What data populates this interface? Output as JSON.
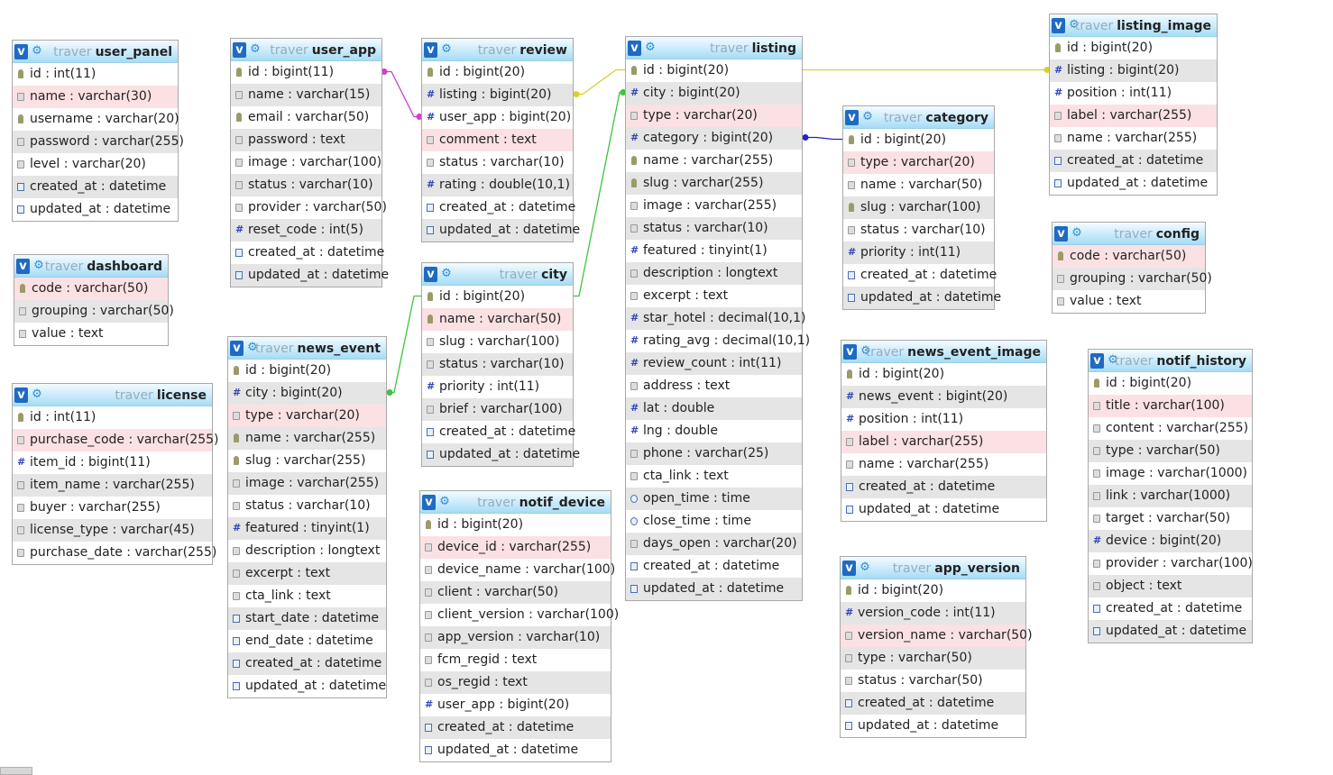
{
  "db_name": "traver",
  "toggle_glyph": "v",
  "gear_icon": "settings-icon",
  "relation_colors": {
    "user_app": "#d23cd0",
    "listing": "#d8d12a",
    "city": "#3ec43e",
    "category": "#2323c8"
  },
  "tables": [
    {
      "name": "user_panel",
      "columns": [
        {
          "text": "id : int(11)",
          "icon": "key"
        },
        {
          "text": "name : varchar(30)",
          "icon": "str",
          "hl": true
        },
        {
          "text": "username : varchar(20)",
          "icon": "key"
        },
        {
          "text": "password : varchar(255)",
          "icon": "str"
        },
        {
          "text": "level : varchar(20)",
          "icon": "str"
        },
        {
          "text": "created_at : datetime",
          "icon": "date"
        },
        {
          "text": "updated_at : datetime",
          "icon": "date"
        }
      ]
    },
    {
      "name": "user_app",
      "columns": [
        {
          "text": "id : bigint(11)",
          "icon": "key"
        },
        {
          "text": "name : varchar(15)",
          "icon": "str"
        },
        {
          "text": "email : varchar(50)",
          "icon": "key"
        },
        {
          "text": "password : text",
          "icon": "str"
        },
        {
          "text": "image : varchar(100)",
          "icon": "str"
        },
        {
          "text": "status : varchar(10)",
          "icon": "str"
        },
        {
          "text": "provider : varchar(50)",
          "icon": "str"
        },
        {
          "text": "reset_code : int(5)",
          "icon": "num"
        },
        {
          "text": "created_at : datetime",
          "icon": "date"
        },
        {
          "text": "updated_at : datetime",
          "icon": "date"
        }
      ]
    },
    {
      "name": "review",
      "columns": [
        {
          "text": "id : bigint(20)",
          "icon": "key"
        },
        {
          "text": "listing : bigint(20)",
          "icon": "num"
        },
        {
          "text": "user_app : bigint(20)",
          "icon": "num"
        },
        {
          "text": "comment : text",
          "icon": "str",
          "hl": true
        },
        {
          "text": "status : varchar(10)",
          "icon": "str"
        },
        {
          "text": "rating : double(10,1)",
          "icon": "num"
        },
        {
          "text": "created_at : datetime",
          "icon": "date"
        },
        {
          "text": "updated_at : datetime",
          "icon": "date"
        }
      ]
    },
    {
      "name": "listing",
      "columns": [
        {
          "text": "id : bigint(20)",
          "icon": "key"
        },
        {
          "text": "city : bigint(20)",
          "icon": "num"
        },
        {
          "text": "type : varchar(20)",
          "icon": "str",
          "hl": true
        },
        {
          "text": "category : bigint(20)",
          "icon": "num"
        },
        {
          "text": "name : varchar(255)",
          "icon": "key"
        },
        {
          "text": "slug : varchar(255)",
          "icon": "key"
        },
        {
          "text": "image : varchar(255)",
          "icon": "str"
        },
        {
          "text": "status : varchar(10)",
          "icon": "str"
        },
        {
          "text": "featured : tinyint(1)",
          "icon": "num"
        },
        {
          "text": "description : longtext",
          "icon": "str"
        },
        {
          "text": "excerpt : text",
          "icon": "str"
        },
        {
          "text": "star_hotel : decimal(10,1)",
          "icon": "num"
        },
        {
          "text": "rating_avg : decimal(10,1)",
          "icon": "num"
        },
        {
          "text": "review_count : int(11)",
          "icon": "num"
        },
        {
          "text": "address : text",
          "icon": "str"
        },
        {
          "text": "lat : double",
          "icon": "num"
        },
        {
          "text": "lng : double",
          "icon": "num"
        },
        {
          "text": "phone : varchar(25)",
          "icon": "str"
        },
        {
          "text": "cta_link : text",
          "icon": "str"
        },
        {
          "text": "open_time : time",
          "icon": "time"
        },
        {
          "text": "close_time : time",
          "icon": "time"
        },
        {
          "text": "days_open : varchar(20)",
          "icon": "str"
        },
        {
          "text": "created_at : datetime",
          "icon": "date"
        },
        {
          "text": "updated_at : datetime",
          "icon": "date"
        }
      ]
    },
    {
      "name": "listing_image",
      "columns": [
        {
          "text": "id : bigint(20)",
          "icon": "key"
        },
        {
          "text": "listing : bigint(20)",
          "icon": "num"
        },
        {
          "text": "position : int(11)",
          "icon": "num"
        },
        {
          "text": "label : varchar(255)",
          "icon": "str",
          "hl": true
        },
        {
          "text": "name : varchar(255)",
          "icon": "str"
        },
        {
          "text": "created_at : datetime",
          "icon": "date"
        },
        {
          "text": "updated_at : datetime",
          "icon": "date"
        }
      ]
    },
    {
      "name": "category",
      "columns": [
        {
          "text": "id : bigint(20)",
          "icon": "key"
        },
        {
          "text": "type : varchar(20)",
          "icon": "str",
          "hl": true
        },
        {
          "text": "name : varchar(50)",
          "icon": "str"
        },
        {
          "text": "slug : varchar(100)",
          "icon": "key"
        },
        {
          "text": "status : varchar(10)",
          "icon": "str"
        },
        {
          "text": "priority : int(11)",
          "icon": "num"
        },
        {
          "text": "created_at : datetime",
          "icon": "date"
        },
        {
          "text": "updated_at : datetime",
          "icon": "date"
        }
      ]
    },
    {
      "name": "config",
      "columns": [
        {
          "text": "code : varchar(50)",
          "icon": "key",
          "hl": true
        },
        {
          "text": "grouping : varchar(50)",
          "icon": "str"
        },
        {
          "text": "value : text",
          "icon": "str"
        }
      ]
    },
    {
      "name": "dashboard",
      "columns": [
        {
          "text": "code : varchar(50)",
          "icon": "key",
          "hl": true
        },
        {
          "text": "grouping : varchar(50)",
          "icon": "str"
        },
        {
          "text": "value : text",
          "icon": "str"
        }
      ]
    },
    {
      "name": "city",
      "columns": [
        {
          "text": "id : bigint(20)",
          "icon": "key"
        },
        {
          "text": "name : varchar(50)",
          "icon": "key",
          "hl": true
        },
        {
          "text": "slug : varchar(100)",
          "icon": "str"
        },
        {
          "text": "status : varchar(10)",
          "icon": "str"
        },
        {
          "text": "priority : int(11)",
          "icon": "num"
        },
        {
          "text": "brief : varchar(100)",
          "icon": "str"
        },
        {
          "text": "created_at : datetime",
          "icon": "date"
        },
        {
          "text": "updated_at : datetime",
          "icon": "date"
        }
      ]
    },
    {
      "name": "news_event",
      "columns": [
        {
          "text": "id : bigint(20)",
          "icon": "key"
        },
        {
          "text": "city : bigint(20)",
          "icon": "num"
        },
        {
          "text": "type : varchar(20)",
          "icon": "str",
          "hl": true
        },
        {
          "text": "name : varchar(255)",
          "icon": "key"
        },
        {
          "text": "slug : varchar(255)",
          "icon": "key"
        },
        {
          "text": "image : varchar(255)",
          "icon": "str"
        },
        {
          "text": "status : varchar(10)",
          "icon": "str"
        },
        {
          "text": "featured : tinyint(1)",
          "icon": "num"
        },
        {
          "text": "description : longtext",
          "icon": "str"
        },
        {
          "text": "excerpt : text",
          "icon": "str"
        },
        {
          "text": "cta_link : text",
          "icon": "str"
        },
        {
          "text": "start_date : datetime",
          "icon": "date"
        },
        {
          "text": "end_date : datetime",
          "icon": "date"
        },
        {
          "text": "created_at : datetime",
          "icon": "date"
        },
        {
          "text": "updated_at : datetime",
          "icon": "date"
        }
      ]
    },
    {
      "name": "license",
      "columns": [
        {
          "text": "id : int(11)",
          "icon": "key"
        },
        {
          "text": "purchase_code : varchar(255)",
          "icon": "str",
          "hl": true
        },
        {
          "text": "item_id : bigint(11)",
          "icon": "num"
        },
        {
          "text": "item_name : varchar(255)",
          "icon": "str"
        },
        {
          "text": "buyer : varchar(255)",
          "icon": "str"
        },
        {
          "text": "license_type : varchar(45)",
          "icon": "str"
        },
        {
          "text": "purchase_date : varchar(255)",
          "icon": "str"
        }
      ]
    },
    {
      "name": "news_event_image",
      "columns": [
        {
          "text": "id : bigint(20)",
          "icon": "key"
        },
        {
          "text": "news_event : bigint(20)",
          "icon": "num"
        },
        {
          "text": "position : int(11)",
          "icon": "num"
        },
        {
          "text": "label : varchar(255)",
          "icon": "str",
          "hl": true
        },
        {
          "text": "name : varchar(255)",
          "icon": "str"
        },
        {
          "text": "created_at : datetime",
          "icon": "date"
        },
        {
          "text": "updated_at : datetime",
          "icon": "date"
        }
      ]
    },
    {
      "name": "notif_history",
      "columns": [
        {
          "text": "id : bigint(20)",
          "icon": "key"
        },
        {
          "text": "title : varchar(100)",
          "icon": "str",
          "hl": true
        },
        {
          "text": "content : varchar(255)",
          "icon": "str"
        },
        {
          "text": "type : varchar(50)",
          "icon": "str"
        },
        {
          "text": "image : varchar(1000)",
          "icon": "str"
        },
        {
          "text": "link : varchar(1000)",
          "icon": "str"
        },
        {
          "text": "target : varchar(50)",
          "icon": "str"
        },
        {
          "text": "device : bigint(20)",
          "icon": "num"
        },
        {
          "text": "provider : varchar(100)",
          "icon": "str"
        },
        {
          "text": "object : text",
          "icon": "str"
        },
        {
          "text": "created_at : datetime",
          "icon": "date"
        },
        {
          "text": "updated_at : datetime",
          "icon": "date"
        }
      ]
    },
    {
      "name": "notif_device",
      "columns": [
        {
          "text": "id : bigint(20)",
          "icon": "key"
        },
        {
          "text": "device_id : varchar(255)",
          "icon": "str",
          "hl": true
        },
        {
          "text": "device_name : varchar(100)",
          "icon": "str"
        },
        {
          "text": "client : varchar(50)",
          "icon": "str"
        },
        {
          "text": "client_version : varchar(100)",
          "icon": "str"
        },
        {
          "text": "app_version : varchar(10)",
          "icon": "str"
        },
        {
          "text": "fcm_regid : text",
          "icon": "str"
        },
        {
          "text": "os_regid : text",
          "icon": "str"
        },
        {
          "text": "user_app : bigint(20)",
          "icon": "num"
        },
        {
          "text": "created_at : datetime",
          "icon": "date"
        },
        {
          "text": "updated_at : datetime",
          "icon": "date"
        }
      ]
    },
    {
      "name": "app_version",
      "columns": [
        {
          "text": "id : bigint(20)",
          "icon": "key"
        },
        {
          "text": "version_code : int(11)",
          "icon": "num"
        },
        {
          "text": "version_name : varchar(50)",
          "icon": "str",
          "hl": true
        },
        {
          "text": "type : varchar(50)",
          "icon": "str"
        },
        {
          "text": "status : varchar(50)",
          "icon": "str"
        },
        {
          "text": "created_at : datetime",
          "icon": "date"
        },
        {
          "text": "updated_at : datetime",
          "icon": "date"
        }
      ]
    }
  ]
}
